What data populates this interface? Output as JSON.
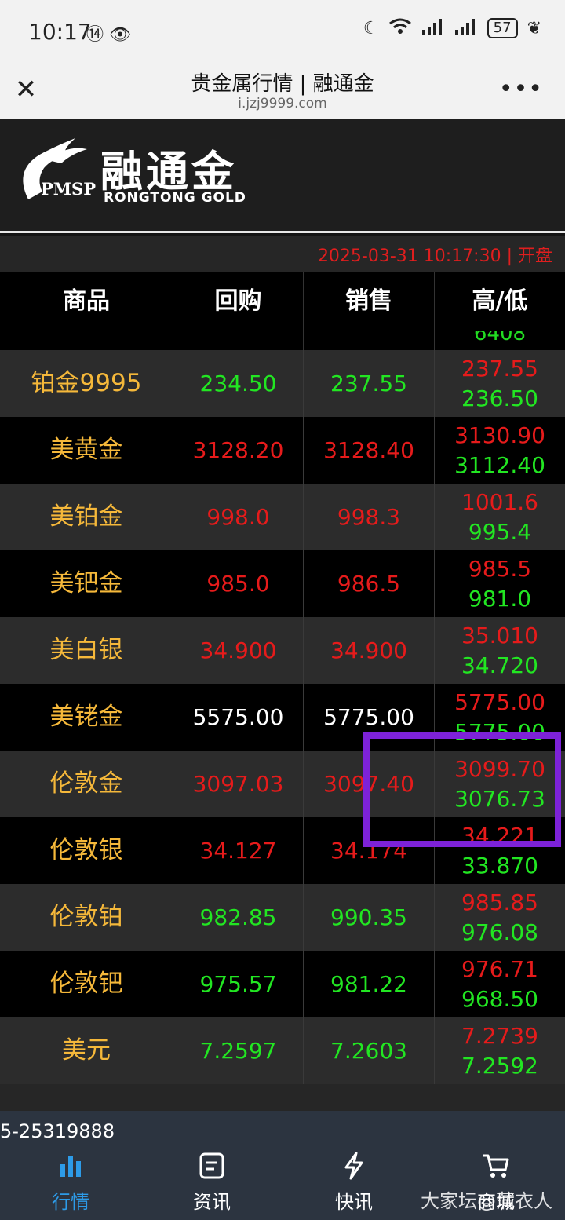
{
  "status": {
    "time": "10:17",
    "battery": "57"
  },
  "browser": {
    "title": "贵金属行情 | 融通金",
    "url": "i.jzj9999.com"
  },
  "logo": {
    "pmsp": "PMSP",
    "cn": "融通金",
    "en": "RONGTONG GOLD"
  },
  "datetime": "2025-03-31 10:17:30 | 开盘",
  "headers": {
    "product": "商品",
    "buy": "回购",
    "sell": "销售",
    "hilo": "高/低"
  },
  "partial_low": "6408",
  "rows": [
    {
      "name": "铂金9995",
      "buy": "234.50",
      "sell": "237.55",
      "high": "237.55",
      "low": "236.50"
    },
    {
      "name": "美黄金",
      "buy": "3128.20",
      "sell": "3128.40",
      "high": "3130.90",
      "low": "3112.40"
    },
    {
      "name": "美铂金",
      "buy": "998.0",
      "sell": "998.3",
      "high": "1001.6",
      "low": "995.4"
    },
    {
      "name": "美钯金",
      "buy": "985.0",
      "sell": "986.5",
      "high": "985.5",
      "low": "981.0"
    },
    {
      "name": "美白银",
      "buy": "34.900",
      "sell": "34.900",
      "high": "35.010",
      "low": "34.720"
    },
    {
      "name": "美铑金",
      "buy": "5575.00",
      "sell": "5775.00",
      "high": "5775.00",
      "low": "5775.00"
    },
    {
      "name": "伦敦金",
      "buy": "3097.03",
      "sell": "3097.40",
      "high": "3099.70",
      "low": "3076.73"
    },
    {
      "name": "伦敦银",
      "buy": "34.127",
      "sell": "34.174",
      "high": "34.221",
      "low": "33.870"
    },
    {
      "name": "伦敦铂",
      "buy": "982.85",
      "sell": "990.35",
      "high": "985.85",
      "low": "976.08"
    },
    {
      "name": "伦敦钯",
      "buy": "975.57",
      "sell": "981.22",
      "high": "976.71",
      "low": "968.50"
    },
    {
      "name": "美元",
      "buy": "7.2597",
      "sell": "7.2603",
      "high": "7.2739",
      "low": "7.2592"
    }
  ],
  "row_colors": [
    "green",
    "red",
    "red",
    "red",
    "red",
    "white",
    "red",
    "red",
    "green",
    "green",
    "green"
  ],
  "phone": "5-25319888",
  "tabs": [
    {
      "label": "行情",
      "icon": "bar-chart-icon",
      "active": true
    },
    {
      "label": "资讯",
      "icon": "document-icon",
      "active": false
    },
    {
      "label": "快讯",
      "icon": "lightning-icon",
      "active": false
    },
    {
      "label": "商城",
      "icon": "cart-icon",
      "active": false
    }
  ],
  "watermark": "大家坛@蒲衣人",
  "colors": {
    "red": "#e61b1b",
    "green": "#22e622",
    "gold": "#f5b83a",
    "active_tab": "#2d9be8",
    "highlight": "#7d22d8"
  }
}
